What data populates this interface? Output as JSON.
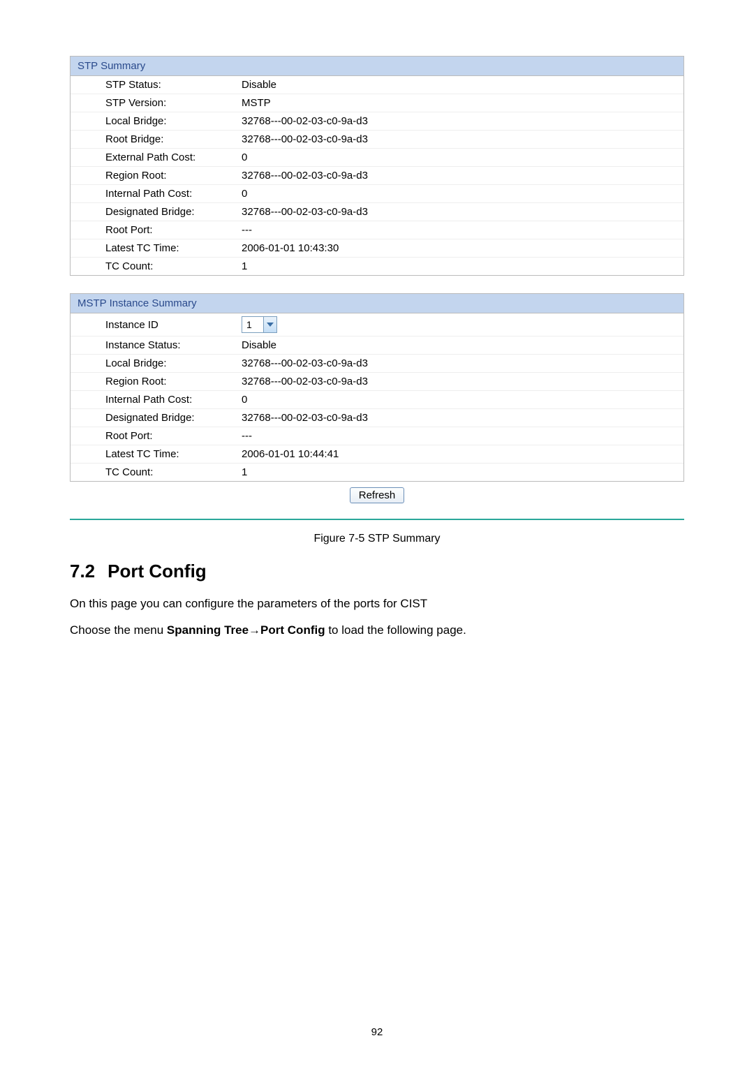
{
  "stp_summary": {
    "header": "STP Summary",
    "rows": [
      {
        "label": "STP Status:",
        "value": "Disable"
      },
      {
        "label": "STP Version:",
        "value": "MSTP"
      },
      {
        "label": "Local Bridge:",
        "value": "32768---00-02-03-c0-9a-d3"
      },
      {
        "label": "Root Bridge:",
        "value": "32768---00-02-03-c0-9a-d3"
      },
      {
        "label": "External Path Cost:",
        "value": "0"
      },
      {
        "label": "Region Root:",
        "value": "32768---00-02-03-c0-9a-d3"
      },
      {
        "label": "Internal Path Cost:",
        "value": "0"
      },
      {
        "label": "Designated Bridge:",
        "value": "32768---00-02-03-c0-9a-d3"
      },
      {
        "label": "Root Port:",
        "value": "---"
      },
      {
        "label": "Latest TC Time:",
        "value": "2006-01-01 10:43:30"
      },
      {
        "label": "TC Count:",
        "value": "1"
      }
    ]
  },
  "mstp_summary": {
    "header": "MSTP Instance Summary",
    "instance_id_label": "Instance ID",
    "instance_id_value": "1",
    "rows": [
      {
        "label": "Instance Status:",
        "value": "Disable"
      },
      {
        "label": "Local Bridge:",
        "value": "32768---00-02-03-c0-9a-d3"
      },
      {
        "label": "Region Root:",
        "value": "32768---00-02-03-c0-9a-d3"
      },
      {
        "label": "Internal Path Cost:",
        "value": "0"
      },
      {
        "label": "Designated Bridge:",
        "value": "32768---00-02-03-c0-9a-d3"
      },
      {
        "label": "Root Port:",
        "value": "---"
      },
      {
        "label": "Latest TC Time:",
        "value": "2006-01-01 10:44:41"
      },
      {
        "label": "TC Count:",
        "value": "1"
      }
    ],
    "refresh_label": "Refresh"
  },
  "figure_caption": "Figure 7-5 STP Summary",
  "section": {
    "number": "7.2",
    "title": "Port Config",
    "para1": "On this page you can configure the parameters of the ports for CIST",
    "para2a": "Choose the menu ",
    "para2b": "Spanning Tree→Port Config",
    "para2c": " to load the following page."
  },
  "page_number": "92"
}
